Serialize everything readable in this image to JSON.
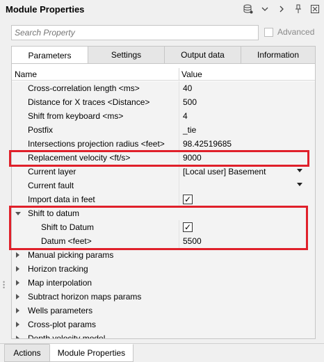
{
  "title": "Module Properties",
  "search": {
    "placeholder": "Search Property"
  },
  "advanced_label": "Advanced",
  "tabs": [
    {
      "label": "Parameters",
      "active": true
    },
    {
      "label": "Settings"
    },
    {
      "label": "Output data"
    },
    {
      "label": "Information"
    }
  ],
  "grid": {
    "col_name": "Name",
    "col_value": "Value",
    "rows": [
      {
        "name": "Cross-correlation length <ms>",
        "value": "40"
      },
      {
        "name": "Distance for X traces <Distance>",
        "value": "500"
      },
      {
        "name": "Shift from keyboard <ms>",
        "value": "4"
      },
      {
        "name": "Postfix",
        "value": "_tie"
      },
      {
        "name": "Intersections projection radius <feet>",
        "value": "98.42519685"
      },
      {
        "name": "Replacement velocity <ft/s>",
        "value": "9000"
      },
      {
        "name": "Current layer",
        "value": "[Local user] Basement"
      },
      {
        "name": "Current fault",
        "value": ""
      },
      {
        "name": "Import data in feet",
        "value": ""
      },
      {
        "name": "Shift to datum",
        "value": ""
      },
      {
        "name": "Shift to Datum",
        "value": ""
      },
      {
        "name": "Datum <feet>",
        "value": "5500"
      },
      {
        "name": "Manual picking params",
        "value": ""
      },
      {
        "name": "Horizon tracking",
        "value": ""
      },
      {
        "name": "Map interpolation",
        "value": ""
      },
      {
        "name": "Subtract horizon maps params",
        "value": ""
      },
      {
        "name": "Wells parameters",
        "value": ""
      },
      {
        "name": "Cross-plot params",
        "value": ""
      },
      {
        "name": "Depth velocity model",
        "value": ""
      }
    ]
  },
  "bottom_tabs": [
    {
      "label": "Actions"
    },
    {
      "label": "Module Properties",
      "active": true
    }
  ],
  "colors": {
    "highlight": "#e0202a"
  },
  "icons": [
    "database-icon",
    "chevron-down-icon",
    "chevron-right-icon",
    "pin-icon",
    "close-icon"
  ]
}
